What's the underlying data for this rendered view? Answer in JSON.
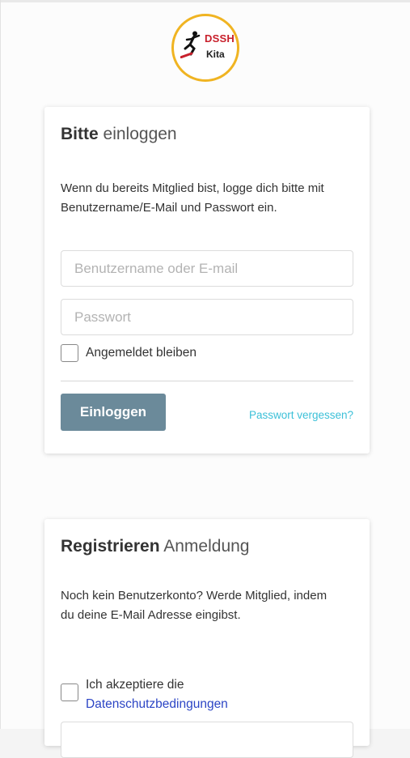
{
  "logo": {
    "top_text": "DSSH",
    "bottom_text": "Kita",
    "ring_color": "#f0b422",
    "accent_color": "#c8202c"
  },
  "login": {
    "title_strong": "Bitte",
    "title_light": "einloggen",
    "description": "Wenn du bereits Mitglied bist, logge dich bitte mit Benutzername/E-Mail und Passwort ein.",
    "username_placeholder": "Benutzername oder E-mail",
    "username_value": "",
    "password_placeholder": "Passwort",
    "password_value": "",
    "remember_label": "Angemeldet bleiben",
    "remember_checked": false,
    "submit_label": "Einloggen",
    "forgot_link": "Passwort vergessen?",
    "button_color": "#6b8a9a",
    "link_color": "#3cc0d8"
  },
  "register": {
    "title_strong": "Registrieren",
    "title_light": "Anmeldung",
    "description": "Noch kein Benutzerkonto? Werde Mitglied, indem du deine E-Mail Adresse eingibst.",
    "privacy_prefix": "Ich akzeptiere die",
    "privacy_link": "Datenschutzbedingungen",
    "privacy_checked": false,
    "email_value": "",
    "link_color": "#2c45c5"
  }
}
